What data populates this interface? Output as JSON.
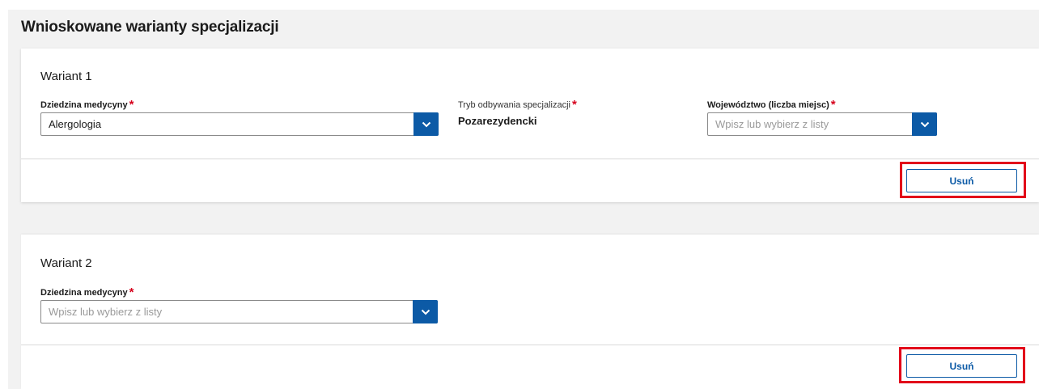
{
  "section": {
    "title": "Wnioskowane warianty specjalizacji"
  },
  "variants": [
    {
      "title": "Wariant 1",
      "field": {
        "label": "Dziedzina medycyny",
        "value": "Alergologia",
        "placeholder": ""
      },
      "mode": {
        "label": "Tryb odbywania specjalizacji",
        "value": "Pozarezydencki"
      },
      "region": {
        "label": "Województwo (liczba miejsc)",
        "value": "",
        "placeholder": "Wpisz lub wybierz z listy"
      },
      "remove_label": "Usuń"
    },
    {
      "title": "Wariant 2",
      "field": {
        "label": "Dziedzina medycyny",
        "value": "",
        "placeholder": "Wpisz lub wybierz z listy"
      },
      "remove_label": "Usuń"
    }
  ],
  "required_mark": "*",
  "icons": {
    "dropdown": "chevron-down-icon"
  },
  "colors": {
    "primary": "#0c5aa6",
    "required": "#d6001c",
    "highlight": "#e2001a",
    "background": "#f2f2f2"
  }
}
